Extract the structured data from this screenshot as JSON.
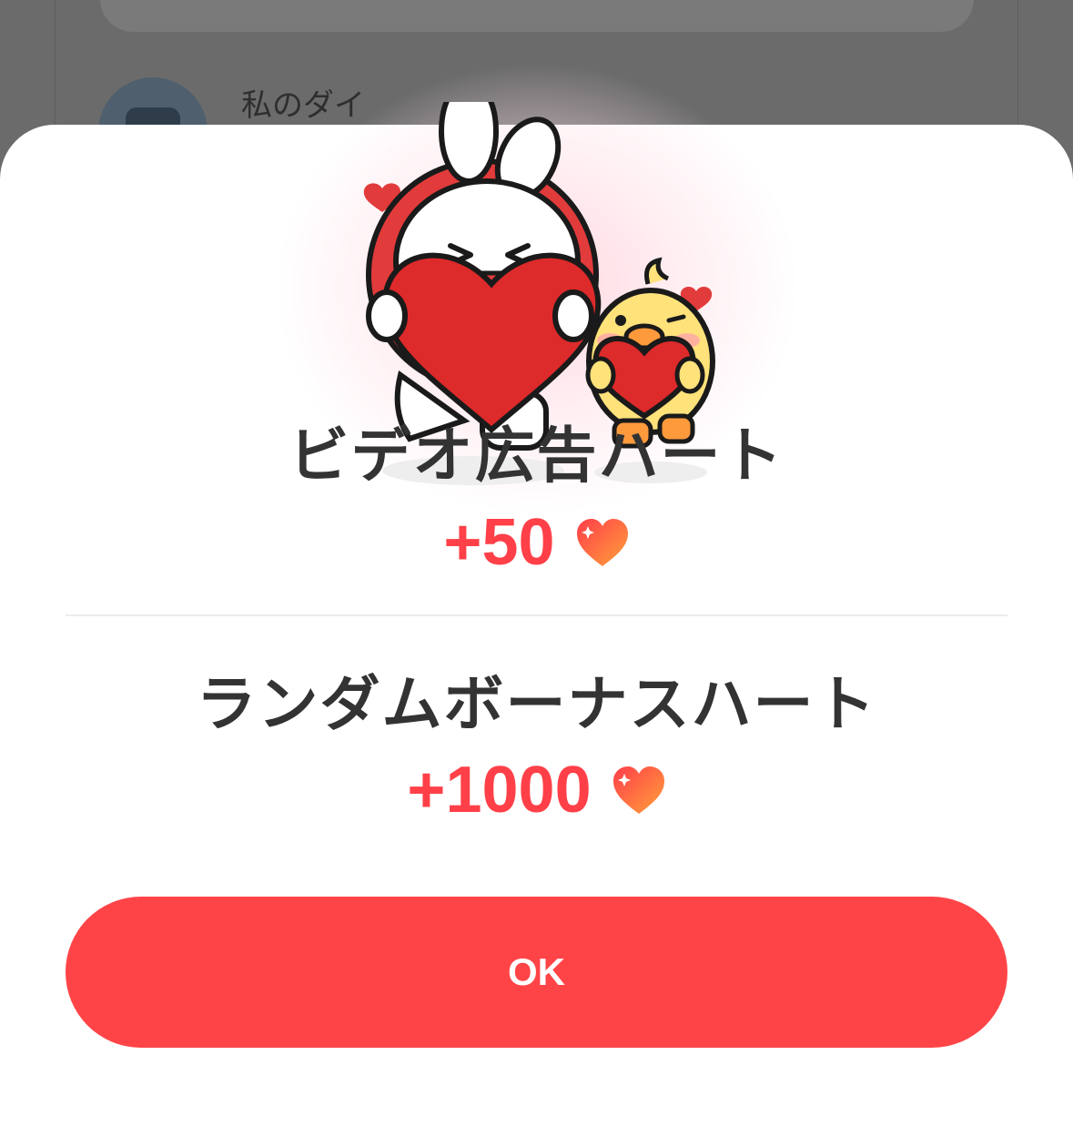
{
  "background": {
    "list_item_label": "私のダイ"
  },
  "dialog": {
    "rewards": [
      {
        "title": "ビデオ広告ハート",
        "amount": "+50",
        "icon": "heart-icon"
      },
      {
        "title": "ランダムボーナスハート",
        "amount": "+1000",
        "icon": "heart-icon"
      }
    ],
    "ok_label": "OK",
    "colors": {
      "accent": "#ff4447",
      "amount_text": "#ff4048",
      "title_text": "#333333"
    },
    "illustration": "bunny-and-chick-holding-hearts"
  }
}
